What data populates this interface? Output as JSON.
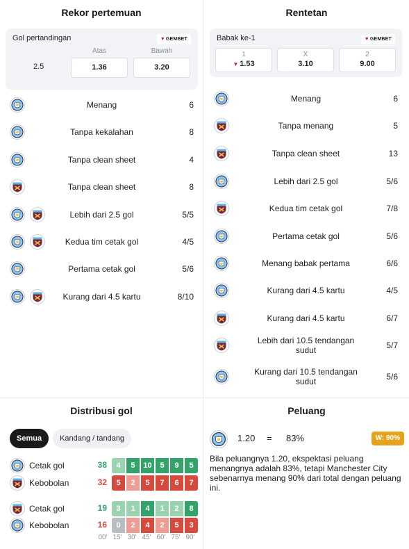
{
  "colors": {
    "green_dark": "#33a36b",
    "green_light": "#9bd3b0",
    "red_dark": "#d6493d",
    "red_light": "#ee9d95",
    "gray": "#b8bcc3",
    "mci_blue": "#8ec5ea",
    "whu_claret": "#7a263a",
    "w_badge": "#e6a21c"
  },
  "rekor": {
    "title": "Rekor pertemuan",
    "odds": {
      "label": "Gol pertandingan",
      "bookmaker": "GEMBET",
      "line": "2.5",
      "over_label": "Atas",
      "under_label": "Bawah",
      "over_value": "1.36",
      "under_value": "3.20"
    },
    "rows": [
      {
        "teams": [
          "mci"
        ],
        "label": "Menang",
        "value": "6"
      },
      {
        "teams": [
          "mci"
        ],
        "label": "Tanpa kekalahan",
        "value": "8"
      },
      {
        "teams": [
          "mci"
        ],
        "label": "Tanpa clean sheet",
        "value": "4"
      },
      {
        "teams": [
          "whu"
        ],
        "label": "Tanpa clean sheet",
        "value": "8"
      },
      {
        "teams": [
          "mci",
          "whu"
        ],
        "label": "Lebih dari 2.5 gol",
        "value": "5/5"
      },
      {
        "teams": [
          "mci",
          "whu"
        ],
        "label": "Kedua tim cetak gol",
        "value": "4/5"
      },
      {
        "teams": [
          "mci"
        ],
        "label": "Pertama cetak gol",
        "value": "5/6"
      },
      {
        "teams": [
          "mci",
          "whu"
        ],
        "label": "Kurang dari 4.5 kartu",
        "value": "8/10"
      }
    ]
  },
  "rentetan": {
    "title": "Rentetan",
    "odds": {
      "label": "Babak ke-1",
      "bookmaker": "GEMBET",
      "home_label": "1",
      "draw_label": "X",
      "away_label": "2",
      "home_value": "1.53",
      "draw_value": "3.10",
      "away_value": "9.00"
    },
    "rows": [
      {
        "teams": [
          "mci"
        ],
        "label": "Menang",
        "value": "6"
      },
      {
        "teams": [
          "whu"
        ],
        "label": "Tanpa menang",
        "value": "5"
      },
      {
        "teams": [
          "whu"
        ],
        "label": "Tanpa clean sheet",
        "value": "13"
      },
      {
        "teams": [
          "mci"
        ],
        "label": "Lebih dari 2.5 gol",
        "value": "5/6"
      },
      {
        "teams": [
          "whu"
        ],
        "label": "Kedua tim cetak gol",
        "value": "7/8"
      },
      {
        "teams": [
          "mci"
        ],
        "label": "Pertama cetak gol",
        "value": "5/6"
      },
      {
        "teams": [
          "mci"
        ],
        "label": "Menang babak pertama",
        "value": "6/6"
      },
      {
        "teams": [
          "mci"
        ],
        "label": "Kurang dari 4.5 kartu",
        "value": "4/5"
      },
      {
        "teams": [
          "whu"
        ],
        "label": "Kurang dari 4.5 kartu",
        "value": "6/7"
      },
      {
        "teams": [
          "whu"
        ],
        "label": "Lebih dari 10.5 tendangan sudut",
        "value": "5/7"
      },
      {
        "teams": [
          "mci"
        ],
        "label": "Kurang dari 10.5 tendangan sudut",
        "value": "5/6"
      }
    ]
  },
  "distribusi": {
    "title": "Distribusi gol",
    "tabs": [
      "Semua",
      "Kandang / tandang"
    ],
    "active_tab": "Semua",
    "ticks": [
      "00'",
      "15'",
      "30'",
      "45'",
      "60'",
      "75'",
      "90'"
    ],
    "rows": [
      {
        "team": "mci",
        "label": "Cetak gol",
        "total": "38",
        "kind": "scored",
        "values": [
          "4",
          "5",
          "10",
          "5",
          "9",
          "5"
        ]
      },
      {
        "team": "whu",
        "label": "Kebobolan",
        "total": "32",
        "kind": "conceded",
        "values": [
          "5",
          "2",
          "5",
          "7",
          "6",
          "7"
        ]
      },
      {
        "team": "whu",
        "label": "Cetak gol",
        "total": "19",
        "kind": "scored",
        "values": [
          "3",
          "1",
          "4",
          "1",
          "2",
          "8"
        ]
      },
      {
        "team": "mci",
        "label": "Kebobolan",
        "total": "16",
        "kind": "conceded",
        "values": [
          "0",
          "2",
          "4",
          "2",
          "5",
          "3"
        ]
      }
    ]
  },
  "peluang": {
    "title": "Peluang",
    "odds": "1.20",
    "equals": "=",
    "implied": "83%",
    "w_badge": "W: 90%",
    "description": "Bila peluangnya 1.20, ekspektasi peluang menangnya adalah 83%, tetapi Manchester City sebenarnya menang 90% dari total dengan peluang ini."
  }
}
